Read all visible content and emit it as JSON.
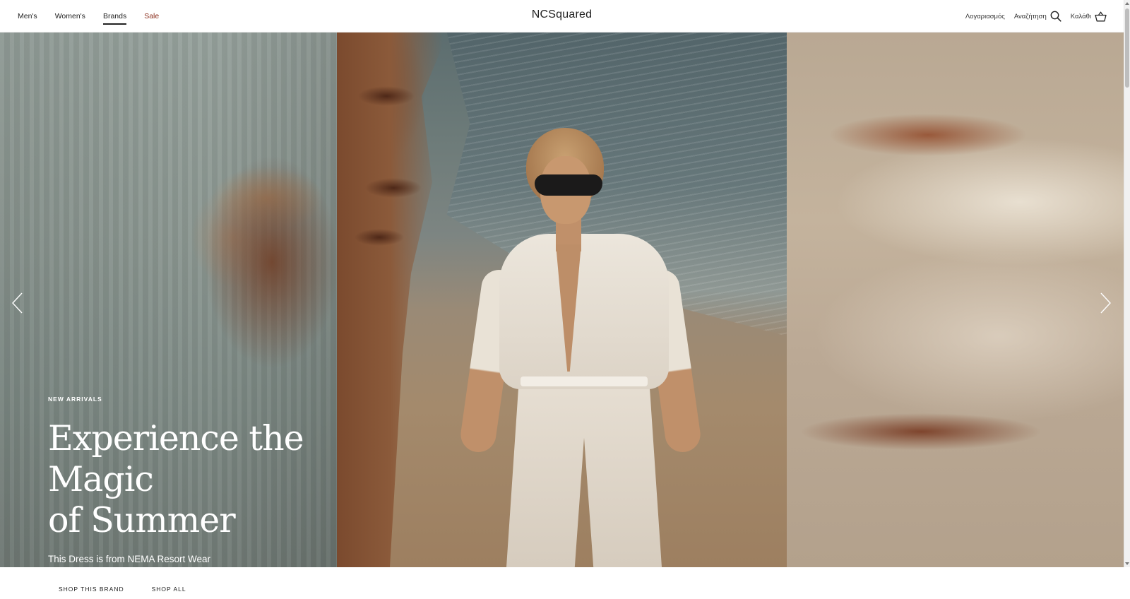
{
  "header": {
    "nav": {
      "mens": "Men's",
      "womens": "Women's",
      "brands": "Brands",
      "sale": "Sale"
    },
    "logo": "NCSquared",
    "utility": {
      "account": "Λογαριασμός",
      "search": "Αναζήτηση",
      "cart": "Καλάθι"
    },
    "active_nav": "Brands"
  },
  "hero": {
    "eyebrow": "NEW ARRIVALS",
    "headline_line1": "Experience the Magic",
    "headline_line2": "of Summer",
    "subheadline": "This Dress is from NEMA Resort Wear",
    "buttons": {
      "shop_brand": "SHOP THIS BRAND",
      "shop_all": "SHOP ALL"
    }
  },
  "icons": {
    "search": "search-icon",
    "cart": "cart-icon",
    "prev": "chevron-left-icon",
    "next": "chevron-right-icon"
  },
  "colors": {
    "sale": "#8a2e1c",
    "text": "#222222",
    "overlay_text": "#ffffff"
  }
}
